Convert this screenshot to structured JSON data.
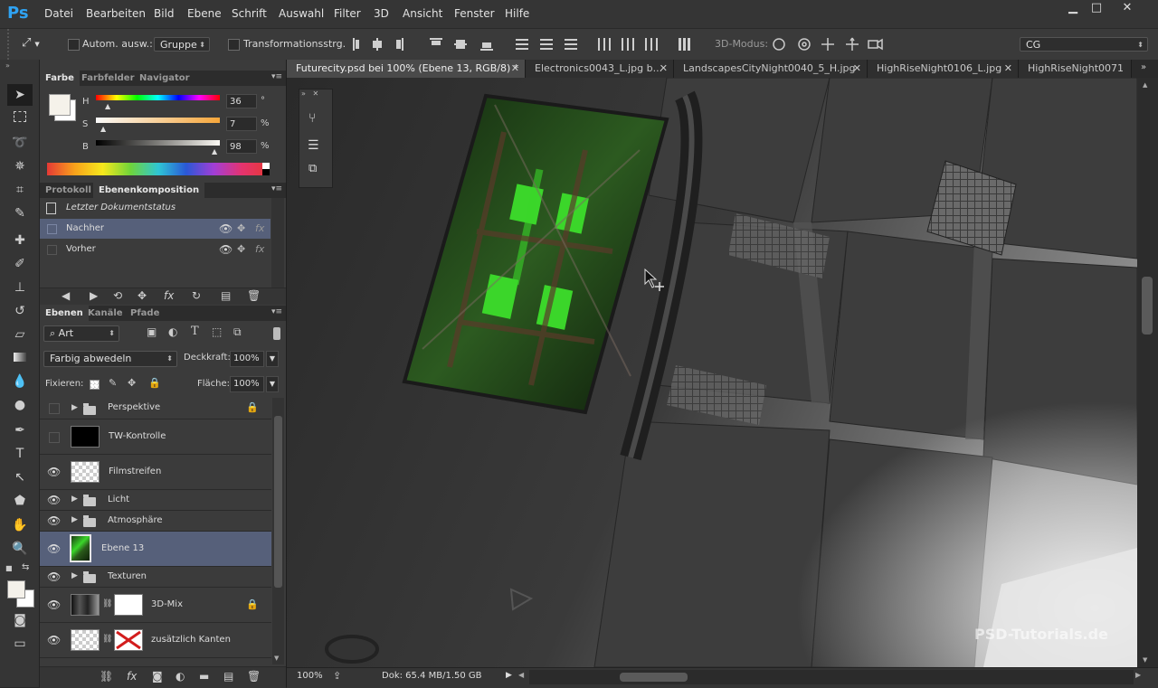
{
  "app": {
    "logo": "Ps"
  },
  "menu": [
    "Datei",
    "Bearbeiten",
    "Bild",
    "Ebene",
    "Schrift",
    "Auswahl",
    "Filter",
    "3D",
    "Ansicht",
    "Fenster",
    "Hilfe"
  ],
  "window_controls": {
    "minimize": "▁",
    "maximize": "□",
    "close": "✕"
  },
  "options": {
    "auto_select_label": "Autom. ausw.:",
    "auto_select_value": "Gruppe",
    "transform_label": "Transformationsstrg.",
    "mode3d_label": "3D-Modus:",
    "workspace": "CG"
  },
  "color_panel": {
    "tabs": [
      "Farbe",
      "Farbfelder",
      "Navigator"
    ],
    "h_label": "H",
    "h_value": "36",
    "h_unit": "°",
    "s_label": "S",
    "s_value": "7",
    "s_unit": "%",
    "b_label": "B",
    "b_value": "98",
    "b_unit": "%"
  },
  "comp_panel": {
    "tabs": [
      "Protokoll",
      "Ebenenkomposition"
    ],
    "last_state": "Letzter Dokumentstatus",
    "items": [
      {
        "label": "Nachher",
        "selected": true
      },
      {
        "label": "Vorher",
        "selected": false
      }
    ]
  },
  "layers_panel": {
    "tabs": [
      "Ebenen",
      "Kanäle",
      "Pfade"
    ],
    "filter": "Art",
    "blend_mode": "Farbig abwedeln",
    "opacity_label": "Deckkraft:",
    "opacity_value": "100%",
    "lock_label": "Fixieren:",
    "fill_label": "Fläche:",
    "fill_value": "100%",
    "layers": [
      {
        "name": "Perspektive",
        "kind": "folder",
        "visible": false,
        "locked": true
      },
      {
        "name": "TW-Kontrolle",
        "kind": "black",
        "visible": false,
        "locked": false
      },
      {
        "name": "Filmstreifen",
        "kind": "transparent",
        "visible": true,
        "locked": false
      },
      {
        "name": "Licht",
        "kind": "folder",
        "visible": true,
        "locked": false
      },
      {
        "name": "Atmosphäre",
        "kind": "folder",
        "visible": true,
        "locked": false
      },
      {
        "name": "Ebene 13",
        "kind": "green",
        "visible": true,
        "locked": false,
        "selected": true
      },
      {
        "name": "Texturen",
        "kind": "folder",
        "visible": true,
        "locked": false
      },
      {
        "name": "3D-Mix",
        "kind": "masked",
        "visible": true,
        "locked": true
      },
      {
        "name": "zusätzlich Kanten",
        "kind": "masked-red",
        "visible": true,
        "locked": false
      }
    ]
  },
  "document_tabs": [
    {
      "label": "Futurecity.psd bei 100% (Ebene 13, RGB/8) *",
      "active": true
    },
    {
      "label": "Electronics0043_L.jpg b...",
      "active": false
    },
    {
      "label": "LandscapesCityNight0040_5_H.jpg",
      "active": false
    },
    {
      "label": "HighRiseNight0106_L.jpg",
      "active": false
    },
    {
      "label": "HighRiseNight0071",
      "active": false
    }
  ],
  "status": {
    "zoom": "100%",
    "doc_info": "Dok: 65.4 MB/1.50 GB"
  },
  "watermark": "PSD-Tutorials.de",
  "colors": {
    "accent_blue": "#2fa3f3",
    "selection": "#56607a",
    "green_glow": "#3bd62a"
  }
}
